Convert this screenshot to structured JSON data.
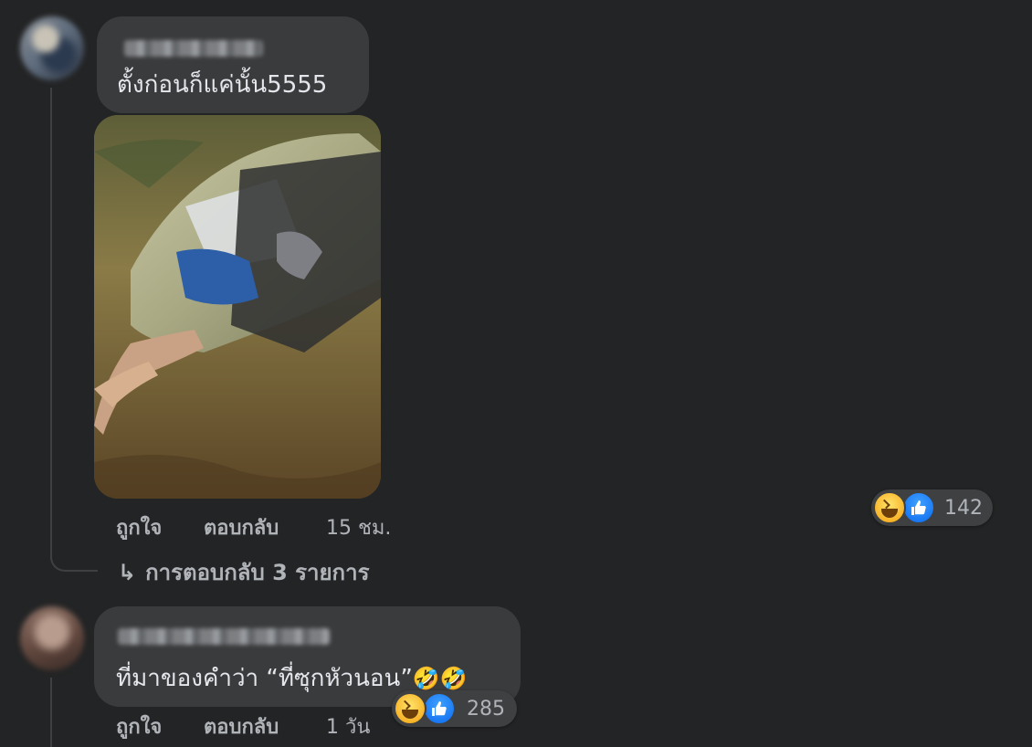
{
  "comments": [
    {
      "author": "",
      "text": "ตั้งก่อนก็แค่นั้น5555",
      "has_photo": true,
      "actions": {
        "like_label": "ถูกใจ",
        "reply_label": "ตอบกลับ",
        "time": "15 ชม."
      },
      "reactions": {
        "icons": [
          "haha-icon",
          "like-icon"
        ],
        "count": "142"
      },
      "replies": {
        "arrow": "↳",
        "label": "การตอบกลับ 3 รายการ"
      }
    },
    {
      "author": "",
      "text": "ที่มาของคำว่า “ที่ซุกหัวนอน”",
      "emoji": "🤣🤣",
      "actions": {
        "like_label": "ถูกใจ",
        "reply_label": "ตอบกลับ",
        "time": "1 วัน"
      },
      "reactions": {
        "icons": [
          "haha-icon",
          "like-icon"
        ],
        "count": "285"
      }
    }
  ],
  "colors": {
    "background": "#232425",
    "bubble": "#3a3b3c",
    "secondary_text": "#b0b3b8",
    "primary_text": "#e4e6eb",
    "like_blue": "#1877f2",
    "haha_yellow": "#f7b125"
  }
}
